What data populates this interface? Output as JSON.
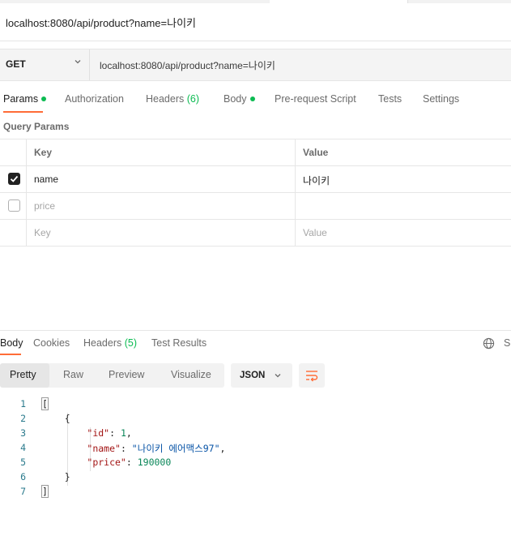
{
  "title": "localhost:8080/api/product?name=나이키",
  "request": {
    "method": "GET",
    "url": "localhost:8080/api/product?name=나이키"
  },
  "request_tabs": [
    {
      "label": "Params",
      "dot": true,
      "active": true
    },
    {
      "label": "Authorization"
    },
    {
      "label": "Headers",
      "count": "(6)"
    },
    {
      "label": "Body",
      "dot": true
    },
    {
      "label": "Pre-request Script"
    },
    {
      "label": "Tests"
    },
    {
      "label": "Settings"
    }
  ],
  "query_params": {
    "section_label": "Query Params",
    "headers": {
      "key": "Key",
      "value": "Value"
    },
    "rows": [
      {
        "checked": true,
        "key": "name",
        "value": "나이키"
      },
      {
        "checked": false,
        "key": "price",
        "value": ""
      }
    ],
    "placeholder": {
      "key": "Key",
      "value": "Value"
    }
  },
  "response_tabs": [
    {
      "label": "Body",
      "active": true
    },
    {
      "label": "Cookies"
    },
    {
      "label": "Headers",
      "count": "(5)"
    },
    {
      "label": "Test Results"
    }
  ],
  "response_right_text": "S",
  "view_modes": [
    "Pretty",
    "Raw",
    "Preview",
    "Visualize"
  ],
  "active_view": "Pretty",
  "format": "JSON",
  "response_body": {
    "line_numbers": [
      "1",
      "2",
      "3",
      "4",
      "5",
      "6",
      "7"
    ],
    "id": "1",
    "name": "나이키 에어맥스97",
    "price": "190000"
  },
  "colors": {
    "accent": "#ff6c37",
    "status_dot": "#0cbb52"
  }
}
